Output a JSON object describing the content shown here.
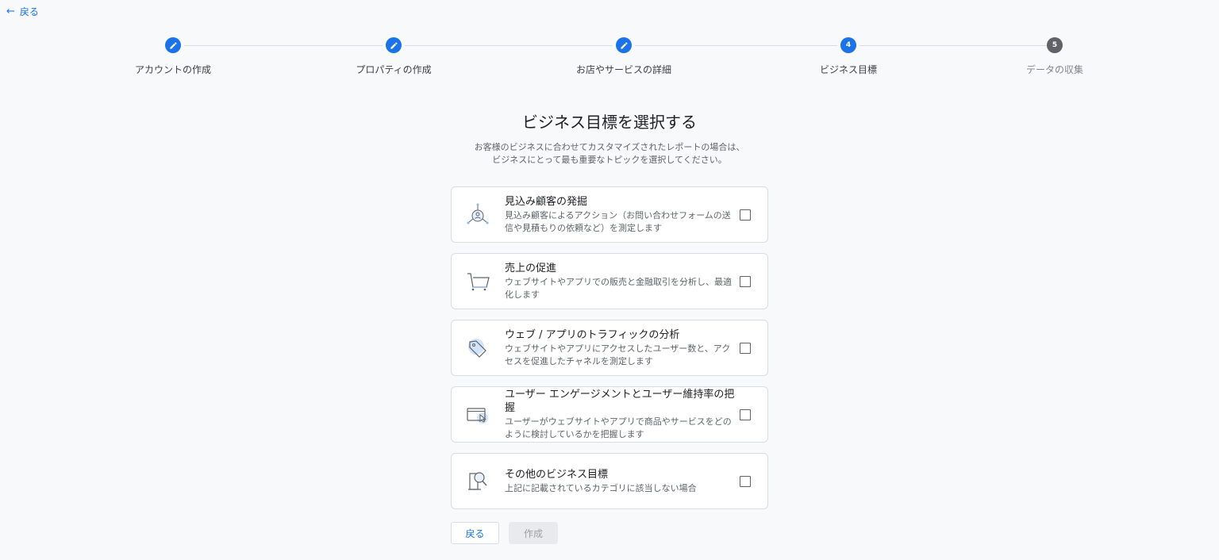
{
  "nav": {
    "back_label": "戻る"
  },
  "steps": [
    {
      "label": "アカウントの作成",
      "state": "done",
      "number": ""
    },
    {
      "label": "プロパティの作成",
      "state": "done",
      "number": ""
    },
    {
      "label": "お店やサービスの詳細",
      "state": "done",
      "number": ""
    },
    {
      "label": "ビジネス目標",
      "state": "current",
      "number": "4"
    },
    {
      "label": "データの収集",
      "state": "todo",
      "number": "5"
    }
  ],
  "page": {
    "title": "ビジネス目標を選択する",
    "subtitle_line1": "お客様のビジネスに合わせてカスタマイズされたレポートの場合は、",
    "subtitle_line2": "ビジネスにとって最も重要なトピックを選択してください。"
  },
  "options": [
    {
      "icon": "lead-generation-icon",
      "title": "見込み顧客の発掘",
      "description": "見込み顧客によるアクション（お問い合わせフォームの送信や見積もりの依頼など）を測定します",
      "checked": false
    },
    {
      "icon": "shopping-cart-icon",
      "title": "売上の促進",
      "description": "ウェブサイトやアプリでの販売と金融取引を分析し、最適化します",
      "checked": false
    },
    {
      "icon": "price-tag-icon",
      "title": "ウェブ / アプリのトラフィックの分析",
      "description": "ウェブサイトやアプリにアクセスしたユーザー数と、アクセスを促進したチャネルを測定します",
      "checked": false
    },
    {
      "icon": "browser-window-cursor-icon",
      "title": "ユーザー エンゲージメントとユーザー維持率の把握",
      "description": "ユーザーがウェブサイトやアプリで商品やサービスをどのように検討しているかを把握します",
      "checked": false
    },
    {
      "icon": "magnifier-document-icon",
      "title": "その他のビジネス目標",
      "description": "上記に記載されているカテゴリに該当しない場合",
      "checked": false
    }
  ],
  "footer": {
    "back_label": "戻る",
    "create_label": "作成"
  },
  "colors": {
    "accent": "#1a73e8",
    "background": "#f8f9fa",
    "step_todo": "#5f6368"
  }
}
